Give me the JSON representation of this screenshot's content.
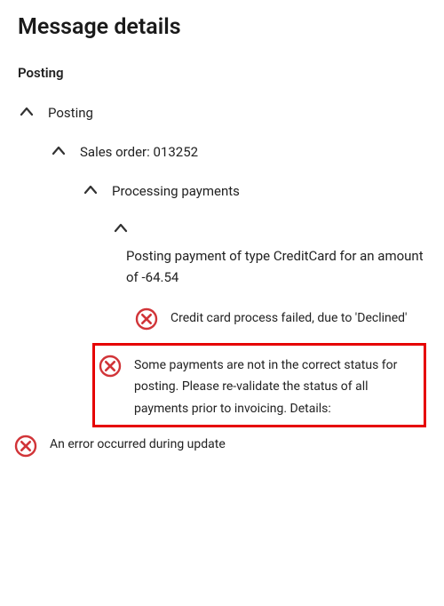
{
  "title": "Message details",
  "section": "Posting",
  "tree": {
    "n0": {
      "label": "Posting"
    },
    "n1": {
      "label": "Sales order: 013252"
    },
    "n2": {
      "label": "Processing payments"
    },
    "n3": {
      "label": "Posting payment of type CreditCard for an amount of -64.54"
    }
  },
  "messages": {
    "m0": "Credit card process failed, due to 'Declined'",
    "m1": "Some payments are not in the correct status for posting. Please re-validate the status of all payments prior to invoicing. Details:",
    "m2": "An error occurred during update"
  }
}
